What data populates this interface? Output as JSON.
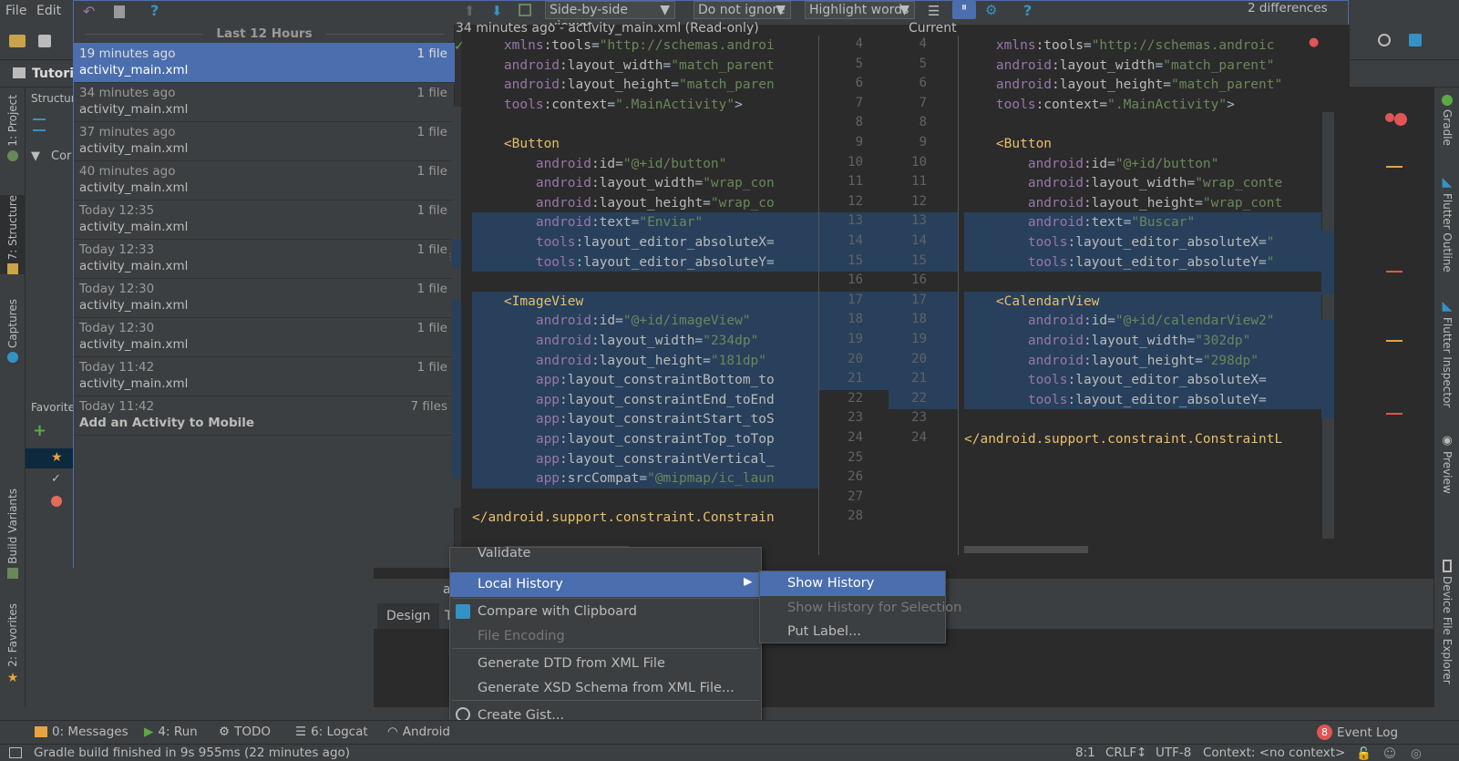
{
  "menubar": {
    "file": "File",
    "edit": "Edit"
  },
  "toolbar": {
    "viewer_select": "Side-by-side viewer",
    "ignore_select": "Do not ignore",
    "highlight_select": "Highlight words",
    "differences": "2 differences"
  },
  "navbar": {
    "project": "Tutoria"
  },
  "left_panel": {
    "structure_title": "Structure",
    "tree_root": "Cor",
    "favorites_title": "Favorites"
  },
  "history": {
    "header": "Last 12 Hours",
    "items": [
      {
        "when": "19 minutes ago",
        "name": "activity_main.xml",
        "count": "1 file"
      },
      {
        "when": "34 minutes ago",
        "name": "activity_main.xml",
        "count": "1 file"
      },
      {
        "when": "37 minutes ago",
        "name": "activity_main.xml",
        "count": "1 file"
      },
      {
        "when": "40 minutes ago",
        "name": "activity_main.xml",
        "count": "1 file"
      },
      {
        "when": "Today 12:35",
        "name": "activity_main.xml",
        "count": "1 file"
      },
      {
        "when": "Today 12:33",
        "name": "activity_main.xml",
        "count": "1 file"
      },
      {
        "when": "Today 12:30",
        "name": "activity_main.xml",
        "count": "1 file"
      },
      {
        "when": "Today 12:30",
        "name": "activity_main.xml",
        "count": "1 file"
      },
      {
        "when": "Today 11:42",
        "name": "activity_main.xml",
        "count": "1 file"
      },
      {
        "when": "Today 11:42",
        "name": "Add an Activity to Mobile",
        "count": "7 files"
      }
    ]
  },
  "diff": {
    "left_title": "34 minutes ago - activity_main.xml (Read-only)",
    "right_title": "Current",
    "left_lines": [
      "    xmlns:tools=\"http://schemas.androi",
      "    android:layout_width=\"match_parent",
      "    android:layout_height=\"match_paren",
      "    tools:context=\".MainActivity\">",
      "",
      "    <Button",
      "        android:id=\"@+id/button\"",
      "        android:layout_width=\"wrap_con",
      "        android:layout_height=\"wrap_co",
      "        android:text=\"Enviar\"",
      "        tools:layout_editor_absoluteX=",
      "        tools:layout_editor_absoluteY=",
      "",
      "    <ImageView",
      "        android:id=\"@+id/imageView\"",
      "        android:layout_width=\"234dp\"",
      "        android:layout_height=\"181dp\"",
      "        app:layout_constraintBottom_to",
      "        app:layout_constraintEnd_toEnd",
      "        app:layout_constraintStart_toS",
      "        app:layout_constraintTop_toTop",
      "        app:layout_constraintVertical_",
      "        app:srcCompat=\"@mipmap/ic_laun",
      "",
      "</android.support.constraint.Constrain"
    ],
    "left_numbers": [
      "4",
      "5",
      "6",
      "7",
      "8",
      "9",
      "10",
      "11",
      "12",
      "13",
      "14",
      "15",
      "16",
      "17",
      "18",
      "19",
      "20",
      "21",
      "22",
      "23",
      "24",
      "25",
      "26",
      "27",
      "28"
    ],
    "right_numbers": [
      "4",
      "5",
      "6",
      "7",
      "8",
      "9",
      "10",
      "11",
      "12",
      "13",
      "14",
      "15",
      "16",
      "17",
      "18",
      "19",
      "20",
      "21",
      "22",
      "23",
      "24"
    ],
    "right_lines": [
      "    xmlns:tools=\"http://schemas.androic",
      "    android:layout_width=\"match_parent\"",
      "    android:layout_height=\"match_parent\"",
      "    tools:context=\".MainActivity\">",
      "",
      "    <Button",
      "        android:id=\"@+id/button\"",
      "        android:layout_width=\"wrap_conte",
      "        android:layout_height=\"wrap_cont",
      "        android:text=\"Buscar\"",
      "        tools:layout_editor_absoluteX=\"",
      "        tools:layout_editor_absoluteY=\"",
      "",
      "    <CalendarView",
      "        android:id=\"@+id/calendarView2\"",
      "        android:layout_width=\"302dp\"",
      "        android:layout_height=\"298dp\"",
      "        tools:layout_editor_absoluteX=",
      "        tools:layout_editor_absoluteY=",
      "",
      "</android.support.constraint.ConstraintL"
    ]
  },
  "context_menu": {
    "partial_top": "Validate",
    "items": [
      {
        "label": "Local History",
        "state": "selected",
        "has_submenu": true
      },
      {
        "label": "Compare with Clipboard",
        "state": "normal"
      },
      {
        "label": "File Encoding",
        "state": "disabled"
      },
      {
        "label": "Generate DTD from XML File",
        "state": "normal"
      },
      {
        "label": "Generate XSD Schema from XML File...",
        "state": "normal"
      },
      {
        "label": "Create Gist...",
        "state": "normal"
      }
    ]
  },
  "submenu": {
    "items": [
      {
        "label": "Show History",
        "state": "selected"
      },
      {
        "label": "Show History for Selection",
        "state": "disabled"
      },
      {
        "label": "Put Label...",
        "state": "normal"
      }
    ]
  },
  "editor_tabs": {
    "design": "Design",
    "text": "T",
    "partial": "a"
  },
  "tool_stripe_left": {
    "project": "1: Project",
    "structure": "7: Structure",
    "captures": "Captures",
    "build_variants": "Build Variants",
    "favorites": "2: Favorites"
  },
  "tool_stripe_right": {
    "gradle": "Gradle",
    "flutter_outline": "Flutter Outline",
    "flutter_inspector": "Flutter Inspector",
    "preview": "Preview",
    "device_explorer": "Device File Explorer"
  },
  "bottom_tools": {
    "messages": "0: Messages",
    "run": "4: Run",
    "todo": "TODO",
    "logcat": "6: Logcat",
    "android": "Android",
    "event_log": "Event Log",
    "event_count": "8"
  },
  "status": {
    "message": "Gradle build finished in 9s 955ms (22 minutes ago)",
    "position": "8:1",
    "line_sep": "CRLF↕",
    "encoding": "UTF-8",
    "context": "Context: <no context>"
  },
  "colors": {
    "selection": "#4b6eaf",
    "diff_changed": "#28405c",
    "bg": "#3c3f41"
  }
}
